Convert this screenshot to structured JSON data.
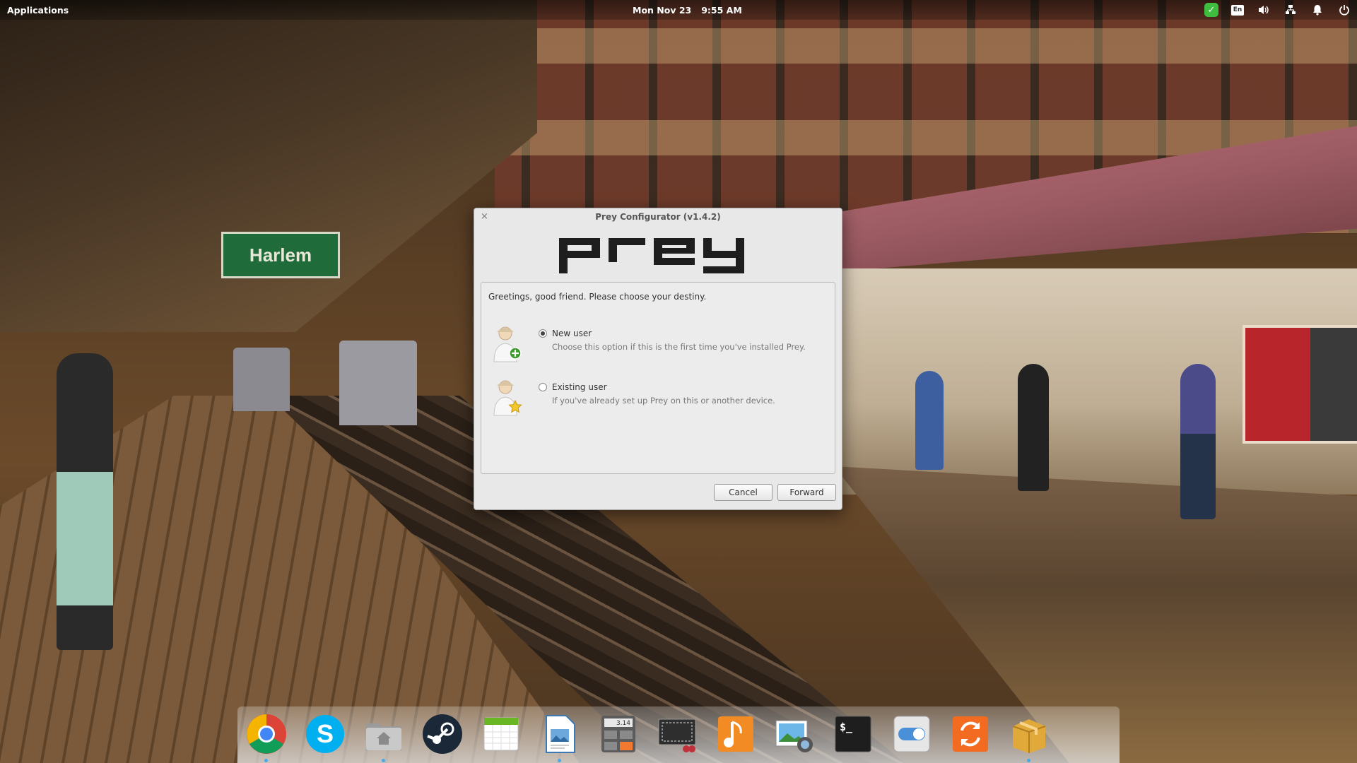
{
  "top_panel": {
    "applications_label": "Applications",
    "date": "Mon Nov 23",
    "time": "9:55 AM",
    "indicators": [
      "check-icon",
      "keyboard-layout-icon",
      "volume-icon",
      "network-icon",
      "notifications-icon",
      "power-icon"
    ],
    "keyboard_layout": "En"
  },
  "wallpaper": {
    "station_sign": "Harlem"
  },
  "dialog": {
    "title": "Prey Configurator (v1.4.2)",
    "close_symbol": "×",
    "logo_text": "prey",
    "greeting": "Greetings, good friend. Please choose your destiny.",
    "options": [
      {
        "label": "New user",
        "description": "Choose this option if this is the first time you've installed Prey.",
        "selected": true,
        "icon": "new-user-icon"
      },
      {
        "label": "Existing user",
        "description": "If you've already set up Prey on this or another device.",
        "selected": false,
        "icon": "existing-user-icon"
      }
    ],
    "cancel_label": "Cancel",
    "forward_label": "Forward"
  },
  "dock": {
    "items": [
      {
        "name": "chrome-icon",
        "running": true
      },
      {
        "name": "skype-icon",
        "running": false
      },
      {
        "name": "files-icon",
        "running": true
      },
      {
        "name": "steam-icon",
        "running": false
      },
      {
        "name": "calendar-icon",
        "running": false
      },
      {
        "name": "document-viewer-icon",
        "running": true
      },
      {
        "name": "calculator-icon",
        "running": false
      },
      {
        "name": "screenshot-icon",
        "running": false
      },
      {
        "name": "music-icon",
        "running": false
      },
      {
        "name": "photos-icon",
        "running": false
      },
      {
        "name": "terminal-icon",
        "running": false
      },
      {
        "name": "settings-switch-icon",
        "running": false
      },
      {
        "name": "software-update-icon",
        "running": false
      },
      {
        "name": "package-installer-icon",
        "running": true
      }
    ],
    "calculator_display": "3.14",
    "terminal_prompt": "$_"
  },
  "colors": {
    "dialog_bg": "#e8e8e8",
    "accent_green": "#3ebd3e",
    "running_dot": "#4aa7e8"
  }
}
